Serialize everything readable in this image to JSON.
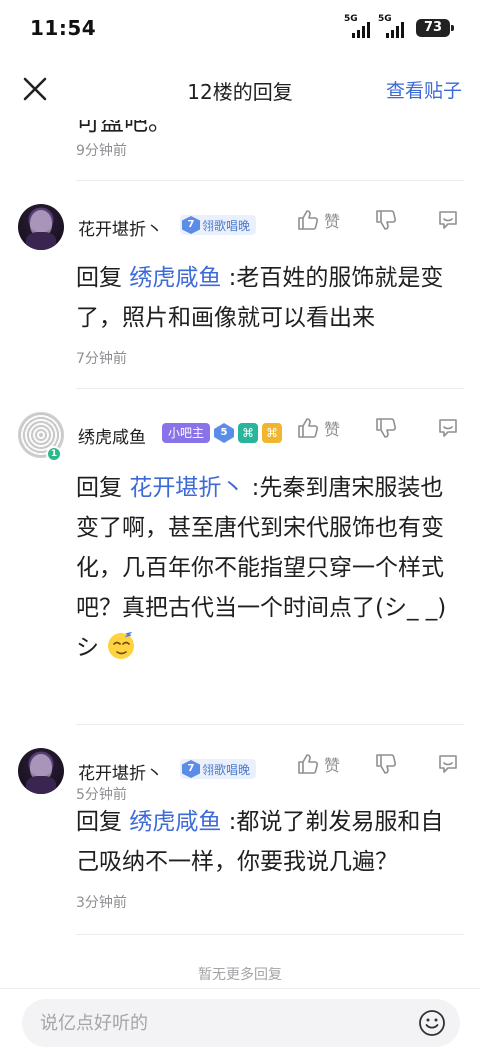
{
  "status_bar": {
    "time": "11:54",
    "signal_1": "5G",
    "signal_2": "5G",
    "battery": "73"
  },
  "header": {
    "title": "12楼的回复",
    "view_post": "查看贴子"
  },
  "previous_reply": {
    "text_fragment": "可盘吧。",
    "time": "9分钟前"
  },
  "replies": [
    {
      "username": "花开堪折丶",
      "level": "7",
      "badge": "翎歌唱晚",
      "like_label": "赞",
      "reply_word": "回复",
      "mention": "绣虎咸鱼",
      "text": " :老百姓的服饰就是变了，照片和画像就可以看出来",
      "time": "7分钟前"
    },
    {
      "username": "绣虎咸鱼",
      "role": "小吧主",
      "level": "5",
      "avatar_badge": "1",
      "like_label": "赞",
      "reply_word": "回复",
      "mention": "花开堪折丶",
      "text": " :先秦到唐宋服装也变了啊，甚至唐代到宋代服饰也有变化，几百年你不能指望只穿一个样式吧？真把古代当一个时间点了(シ_ _)シ",
      "time": "5分钟前"
    },
    {
      "username": "花开堪折丶",
      "level": "7",
      "badge": "翎歌唱晚",
      "like_label": "赞",
      "reply_word": "回复",
      "mention": "绣虎咸鱼",
      "text": " :都说了剃发易服和自己吸纳不一样，你要我说几遍？",
      "time": "3分钟前"
    }
  ],
  "footer": {
    "no_more": "暂无更多回复",
    "input_placeholder": "说亿点好听的"
  },
  "colors": {
    "accent_blue": "#3c6ad6",
    "muted_gray": "#8f8f94",
    "role_purple": "#8a73e8"
  },
  "icons": [
    "close-icon",
    "thumbs-up-icon",
    "thumbs-down-icon",
    "comment-icon",
    "emoji-icon",
    "signal-icon",
    "battery-icon"
  ]
}
